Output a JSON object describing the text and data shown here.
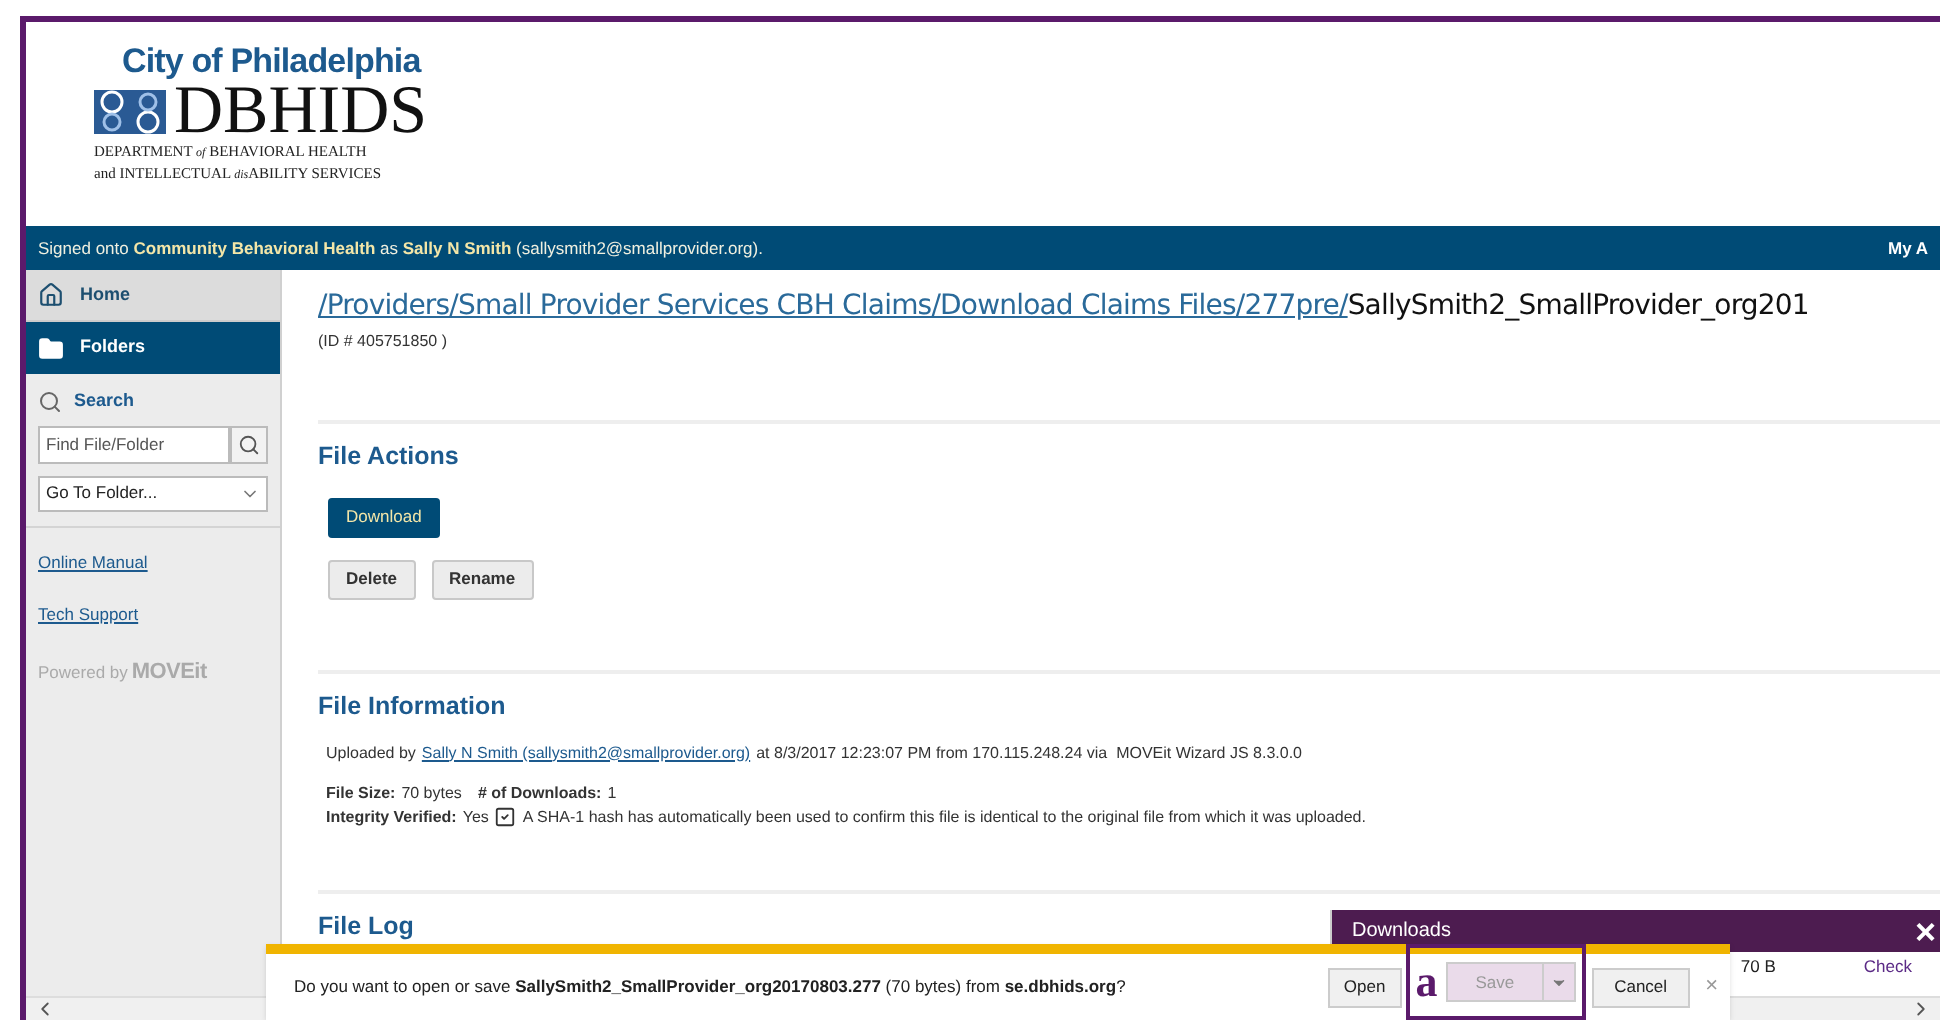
{
  "header": {
    "city": "City of Philadelphia",
    "logo_name": "DBHIDS",
    "subtitle_lines": [
      [
        {
          "text": "DEPARTMENT ",
          "italic": false
        },
        {
          "text": "of",
          "italic": true
        },
        {
          "text": " BEHAVIORAL HEALTH",
          "italic": false
        }
      ],
      [
        {
          "text": "and INTELLECTUAL ",
          "italic": false
        },
        {
          "text": "dis",
          "italic": true
        },
        {
          "text": "ABILITY SERVICES",
          "italic": false
        }
      ]
    ]
  },
  "signed_bar": {
    "text": "Signed onto **Community Behavioral Health** as **Sally N Smith** (sallysmith2@smallprovider.org).",
    "right": "My A"
  },
  "sidebar": {
    "nav": [
      {
        "label": "Home",
        "kind": "home",
        "selected": false
      },
      {
        "label": "Folders",
        "kind": "folder",
        "selected": true
      }
    ],
    "search_label": "Search",
    "search_placeholder": "Find File/Folder",
    "goto": "Go To Folder...",
    "links": [
      "Online Manual",
      "Tech Support"
    ],
    "powered_by": "Powered by",
    "powered_logo": "MOVEit"
  },
  "breadcrumb": {
    "path": "/Providers/Small Provider Services CBH Claims/Download Claims Files/277pre/",
    "current": "SallySmith2_SmallProvider_org201",
    "id": "(ID # 405751850 )"
  },
  "file_actions": {
    "title": "File Actions",
    "primary": "Download",
    "buttons": [
      "Delete",
      "Rename"
    ]
  },
  "file_info": {
    "title": "File Information",
    "uploaded_prefix": "Uploaded by",
    "uploader": "Sally N Smith (sallysmith2@smallprovider.org)",
    "uploaded_rest": "at 8/3/2017 12:23:07 PM from 170.115.248.24 via  MOVEit Wizard JS 8.3.0.0",
    "size_label": "File Size:",
    "size": "70 bytes",
    "downloads_label": "# of Downloads:",
    "downloads": "1",
    "integrity_label": "Integrity Verified:",
    "integrity": "Yes",
    "verified_checked": true,
    "integrity_note": "A SHA-1 hash has automatically been used to confirm this file is identical to the original file from which it was uploaded."
  },
  "file_log": {
    "title": "File Log"
  },
  "download_prompt": {
    "text": "Do you want to open or save **SallySmith2_SmallProvider_org20170803.277** (70 bytes) from **se.dbhids.org**?",
    "open": "Open",
    "save": "Save",
    "save_disabled": true,
    "cancel": "Cancel",
    "close": "×",
    "annotation": "a"
  },
  "downloads_panel": {
    "title": "Downloads",
    "close": "×",
    "size": "70 B",
    "action": "Check"
  }
}
